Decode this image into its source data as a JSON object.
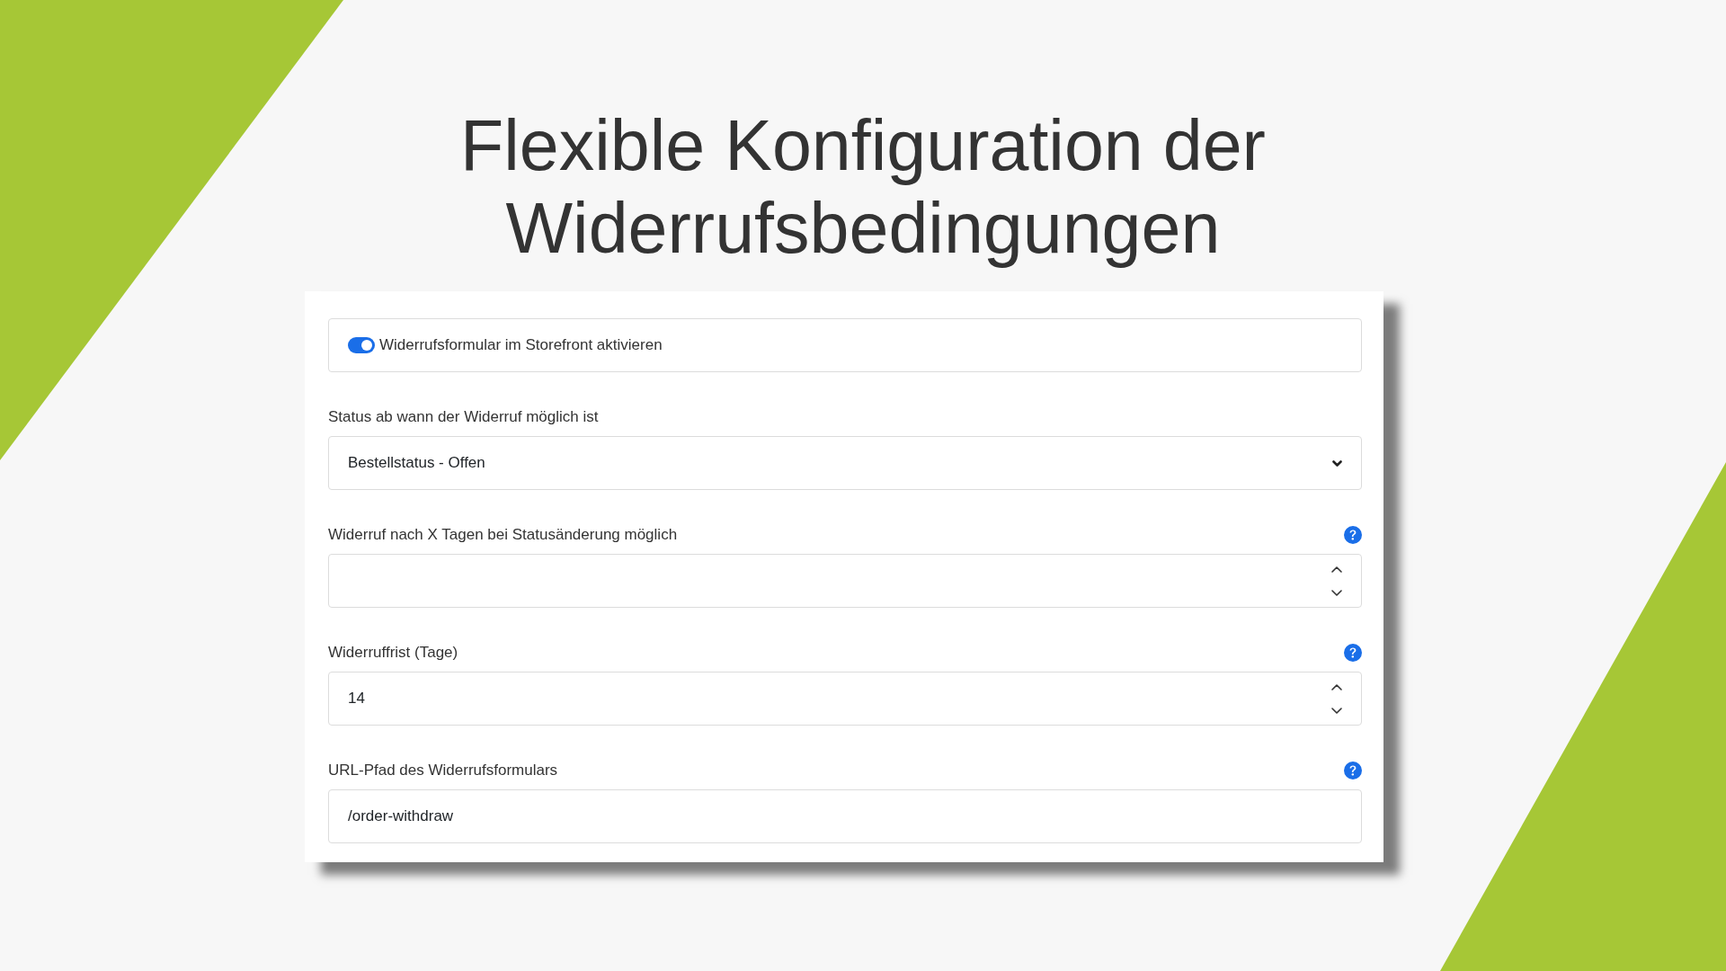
{
  "title_lines": [
    "Flexible Konfiguration der",
    "Widerrufsbedingungen"
  ],
  "form": {
    "toggle": {
      "label": "Widerrufsformular im Storefront aktivieren",
      "on": true
    },
    "fields": [
      {
        "kind": "select",
        "label": "Status ab wann der Widerruf möglich ist",
        "value": "Bestellstatus - Offen",
        "help": false
      },
      {
        "kind": "number",
        "label": "Widerruf nach X Tagen bei Statusänderung möglich",
        "help": true
      },
      {
        "kind": "number",
        "label": "Widerruffrist (Tage)",
        "value": "14",
        "help": true
      },
      {
        "kind": "text",
        "label": "URL-Pfad des Widerrufsformulars",
        "value": "/order-withdraw",
        "help": true
      }
    ]
  }
}
